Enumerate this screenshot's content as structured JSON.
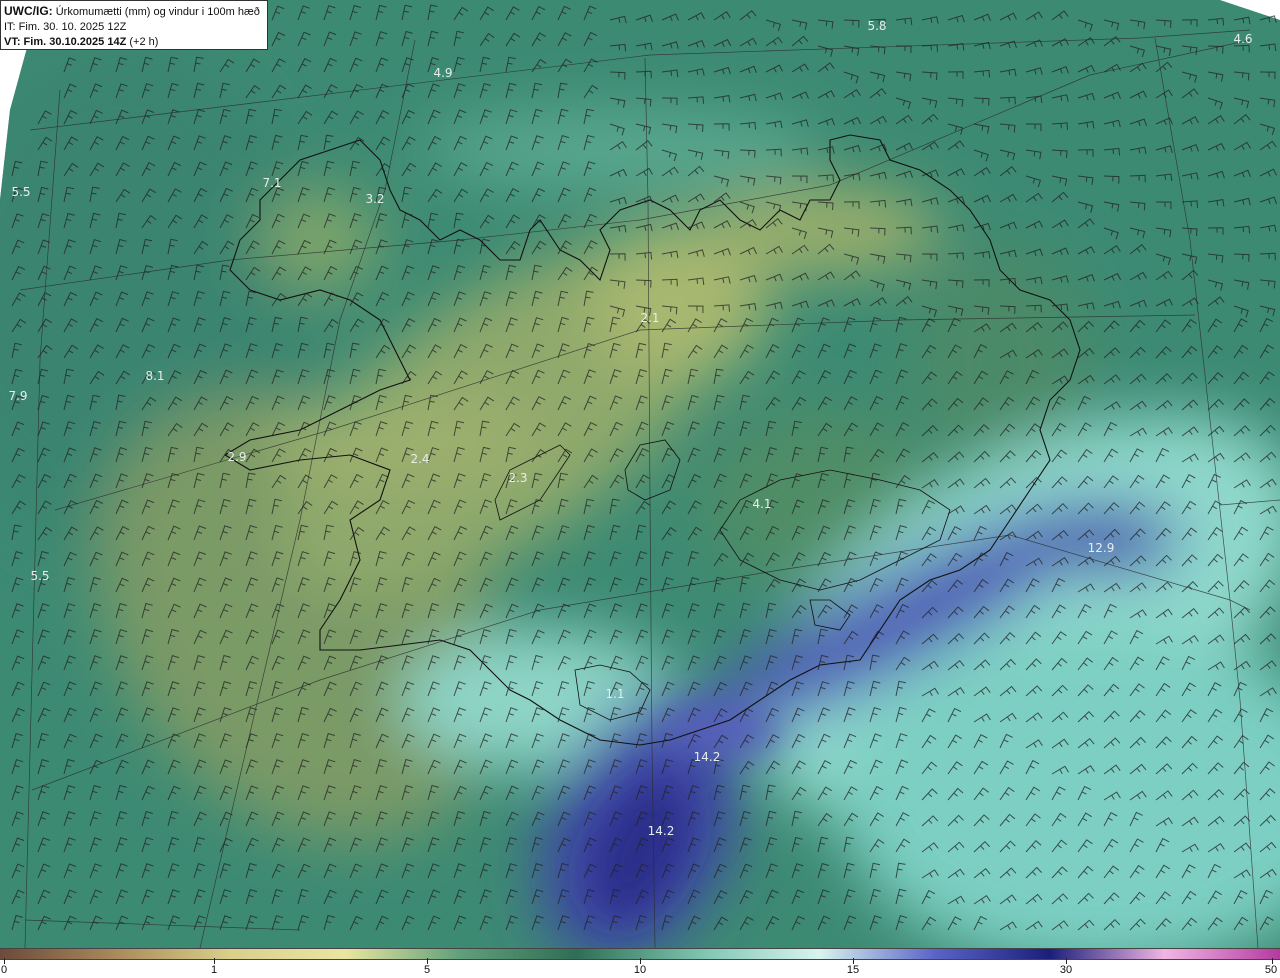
{
  "header": {
    "code": "UWC/IG:",
    "title": "Úrkomumætti (mm) og vindur i 100m hæð",
    "it_line": "IT: Fim. 30. 10. 2025 12Z",
    "vt_prefix": "VT: Fim. 30.10.2025 14Z",
    "vt_suffix": " (+2 h)"
  },
  "map_labels": [
    "5.8",
    "4.6",
    "4.9",
    "5.5",
    "7.1",
    "3.2",
    "2.1",
    "8.1",
    "7.9",
    "2.9",
    "2.4",
    "2.3",
    "4.1",
    "12.9",
    "5.5",
    "1.1",
    "14.2",
    "14.2"
  ],
  "colorbar": {
    "ticks": [
      "0",
      "1",
      "5",
      "10",
      "15",
      "30",
      "50"
    ],
    "colors": [
      "#6b4b3a",
      "#a98a5c",
      "#d9d08a",
      "#e8e6a0",
      "#5f9f7b",
      "#2f6e55",
      "#7fc6b2",
      "#d8f4ef",
      "#5a64c8",
      "#1b1f7a",
      "#f0b6e4",
      "#b43aa0"
    ]
  },
  "map_colors": {
    "sea_teal": "#3f8f78",
    "land_green": "#4e8f68",
    "dry_yellow": "#a8b36e",
    "wet_cyan": "#a9e3dc",
    "heavy_blue": "#4a52b0"
  }
}
